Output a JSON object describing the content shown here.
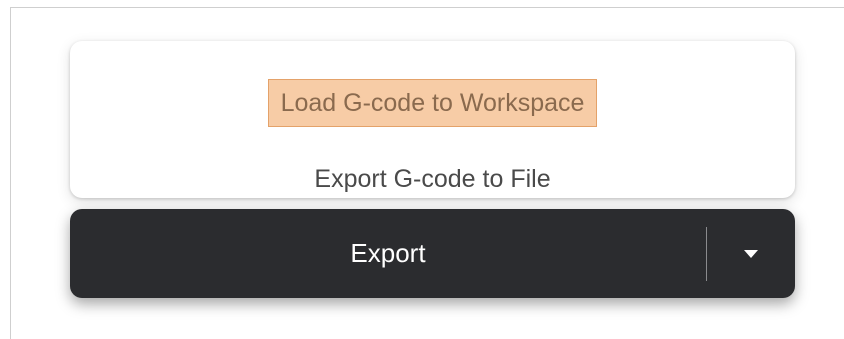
{
  "menu": {
    "items": [
      {
        "label": "Load G-code to Workspace",
        "highlighted": true
      },
      {
        "label": "Export G-code to File",
        "highlighted": false
      }
    ]
  },
  "export_bar": {
    "label": "Export",
    "dropdown_icon": "caret-down-icon"
  },
  "colors": {
    "highlight_fill": "#f7cca6",
    "highlight_border": "#e4a26a",
    "button_bg": "#2b2c2f",
    "menu_text": "#4a4a4a"
  }
}
